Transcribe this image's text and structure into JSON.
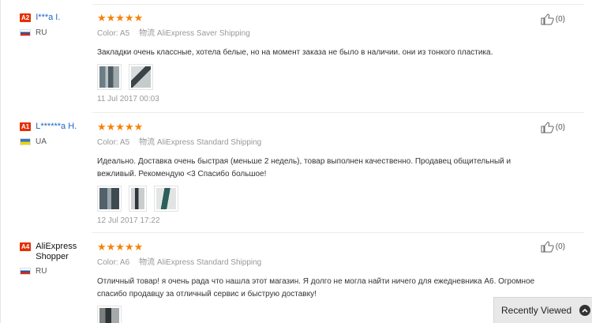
{
  "reviews": [
    {
      "level": "A2",
      "buyer": "I***a I.",
      "country": "RU",
      "stars": "★★★★★",
      "color": "Color: A5",
      "logistics_icon": "物流",
      "shipping": "AliExpress Saver Shipping",
      "text": "Закладки очень классные, хотела белые, но на момент заказа не было в наличии. они из тонкого пластика.",
      "date": "11 Jul 2017 00:03",
      "useful": "(0)"
    },
    {
      "level": "A1",
      "buyer": "L******a H.",
      "country": "UA",
      "stars": "★★★★★",
      "color": "Color: A5",
      "logistics_icon": "物流",
      "shipping": "AliExpress Standard Shipping",
      "text": "Идеально. Доставка очень быстрая (меньше 2 недель), товар выполнен качественно. Продавец общительный и вежливый. Рекомендую <3 Спасибо большое!",
      "date": "12 Jul 2017 17:22",
      "useful": "(0)"
    },
    {
      "level": "A4",
      "buyer": "AliExpress Shopper",
      "country": "RU",
      "stars": "★★★★★",
      "color": "Color: A6",
      "logistics_icon": "物流",
      "shipping": "AliExpress Standard Shipping",
      "text": "Отличный товар! я очень рада что нашла этот магазин. Я долго не могла найти ничего для ежедневника А6. Огромное спасибо продавцу за отличный сервис и быструю доставку!",
      "useful": "(0)"
    }
  ],
  "recently_viewed": "Recently Viewed",
  "colors": {
    "star": "#f5820a",
    "level_badge": "#e62e04",
    "link": "#1a66c7"
  }
}
